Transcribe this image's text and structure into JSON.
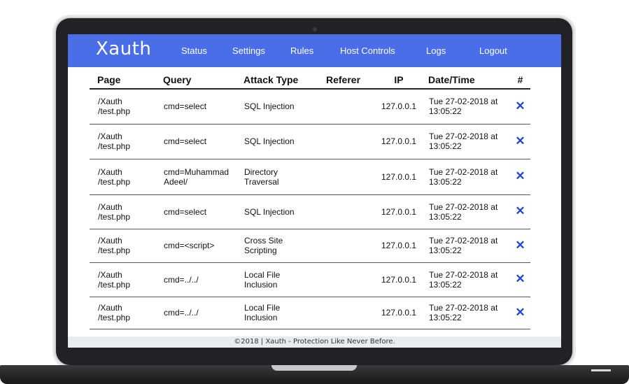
{
  "app": {
    "brand": "Xauth"
  },
  "nav": {
    "items": [
      {
        "label": "Status"
      },
      {
        "label": "Settings"
      },
      {
        "label": "Rules"
      },
      {
        "label": "Host Controls"
      },
      {
        "label": "Logs"
      },
      {
        "label": "Logout"
      }
    ]
  },
  "table": {
    "headers": [
      "Page",
      "Query",
      "Attack Type",
      "Referer",
      "IP",
      "Date/Time",
      "#"
    ],
    "rows": [
      {
        "page1": "/Xauth",
        "page2": "/test.php",
        "query1": "cmd=select",
        "query2": "",
        "attack1": "SQL Injection",
        "attack2": "",
        "referer": "",
        "ip": "127.0.0.1",
        "date1": "Tue 27-02-2018 at",
        "date2": "13:05:22",
        "del": "✕"
      },
      {
        "page1": "/Xauth",
        "page2": "/test.php",
        "query1": "cmd=select",
        "query2": "",
        "attack1": "SQL Injection",
        "attack2": "",
        "referer": "",
        "ip": "127.0.0.1",
        "date1": "Tue 27-02-2018 at",
        "date2": "13:05:22",
        "del": "✕"
      },
      {
        "page1": "/Xauth",
        "page2": "/test.php",
        "query1": "cmd=Muhammad",
        "query2": "Adeel/",
        "attack1": "Directory",
        "attack2": "Traversal",
        "referer": "",
        "ip": "127.0.0.1",
        "date1": "Tue 27-02-2018 at",
        "date2": "13:05:22",
        "del": "✕"
      },
      {
        "page1": "/Xauth",
        "page2": "/test.php",
        "query1": "cmd=select",
        "query2": "",
        "attack1": "SQL Injection",
        "attack2": "",
        "referer": "",
        "ip": "127.0.0.1",
        "date1": "Tue 27-02-2018 at",
        "date2": "13:05:22",
        "del": "✕"
      },
      {
        "page1": "/Xauth",
        "page2": "/test.php",
        "query1": "cmd=<script>",
        "query2": "",
        "attack1": "Cross Site",
        "attack2": "Scripting",
        "referer": "",
        "ip": "127.0.0.1",
        "date1": "Tue 27-02-2018 at",
        "date2": "13:05:22",
        "del": "✕"
      },
      {
        "page1": "/Xauth",
        "page2": "/test.php",
        "query1": "cmd=../../",
        "query2": "",
        "attack1": "Local File",
        "attack2": "Inclusion",
        "referer": "",
        "ip": "127.0.0.1",
        "date1": "Tue 27-02-2018 at",
        "date2": "13:05:22",
        "del": "✕"
      },
      {
        "page1": "/Xauth",
        "page2": "/test.php",
        "query1": "cmd=../../",
        "query2": "",
        "attack1": "Local File",
        "attack2": "Inclusion",
        "referer": "",
        "ip": "127.0.0.1",
        "date1": "Tue 27-02-2018 at",
        "date2": "13:05:22",
        "del": "✕"
      }
    ]
  },
  "footer": {
    "text": "©2018 | Xauth - Protection Like Never Before."
  },
  "colors": {
    "navbar": "#4a6ee8",
    "delete_icon": "#1f46d6",
    "footer_bg": "#e8ecee"
  },
  "icons": {
    "delete": "close-icon"
  }
}
